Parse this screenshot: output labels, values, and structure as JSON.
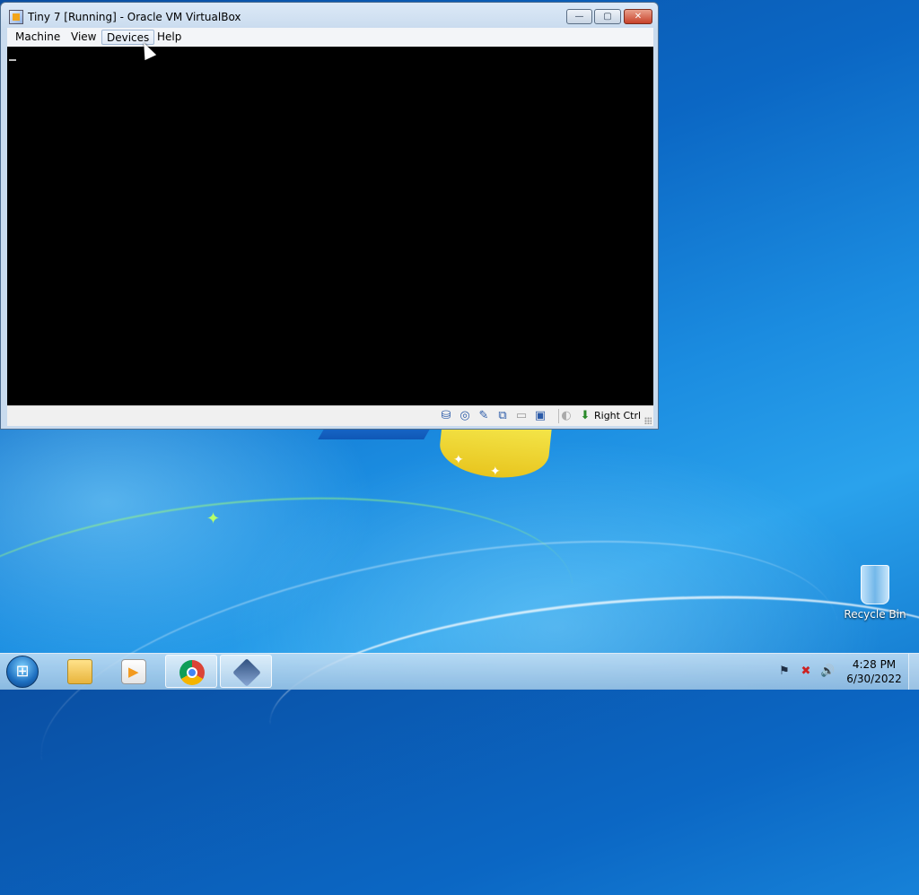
{
  "window": {
    "title": "Tiny 7 [Running] - Oracle VM VirtualBox",
    "controls": {
      "minimize": "—",
      "maximize": "▢",
      "close": "✕"
    }
  },
  "menu": {
    "items": [
      {
        "label": "Machine"
      },
      {
        "label": "View"
      },
      {
        "label": "Devices"
      },
      {
        "label": "Help"
      }
    ]
  },
  "statusbar": {
    "icons": [
      "hard-disk-icon",
      "optical-drive-icon",
      "audio-icon",
      "network-icon",
      "shared-folders-icon",
      "display-icon",
      "video-capture-icon",
      "mouse-integration-icon",
      "keyboard-capture-icon"
    ],
    "host_key": "Right Ctrl"
  },
  "desktop": {
    "recycle_bin_label": "Recycle Bin"
  },
  "taskbar": {
    "pinned": [
      "windows-explorer-icon",
      "media-player-icon",
      "chrome-icon",
      "virtualbox-icon"
    ],
    "tray_icons": [
      "action-center-icon",
      "network-icon",
      "volume-icon"
    ],
    "clock": {
      "time": "4:28 PM",
      "date": "6/30/2022"
    }
  },
  "colors": {
    "desktop_blue": "#0b67c4",
    "vm_screen": "#000000",
    "close_button": "#c7412a"
  }
}
